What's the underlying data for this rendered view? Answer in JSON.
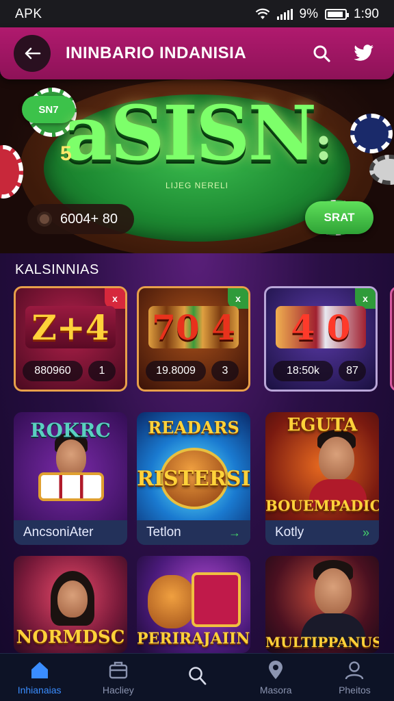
{
  "status_bar": {
    "carrier": "APK",
    "battery_text": "9%",
    "battery_level": 0.9,
    "time": "1:90"
  },
  "app_bar": {
    "back_icon": "arrow-left-icon",
    "title": "ININBARIO INDANISIA",
    "search_icon": "search-icon",
    "bird_icon": "twitter-bird-icon"
  },
  "hero": {
    "logo_text": "aSISN",
    "logo_suffix": ":",
    "subtitle": "LIJEG NERELI",
    "side_digit": "5",
    "badge": "SN7",
    "balance": "6004+ 80",
    "button_label": "SRAT",
    "colors": {
      "felt": "#1d8a32",
      "button": "#3cc24a"
    }
  },
  "section": {
    "title": "KALSINNIAS"
  },
  "slot_cards": [
    {
      "reel_text": "Z+4",
      "stat_left": "880960",
      "stat_right": "1",
      "corner": "x",
      "corner_color": "#d6283c",
      "theme": "#7a1030"
    },
    {
      "reel_text": "70 4",
      "stat_left": "19.8009",
      "stat_right": "3",
      "corner": "x",
      "corner_color": "#2f9b3a",
      "theme": "#6a2a10"
    },
    {
      "reel_text": "4 0",
      "stat_left": "18:50k",
      "stat_right": "87",
      "corner": "x",
      "corner_color": "#2f9b3a",
      "theme": "#2a1e6a"
    }
  ],
  "game_tiles_row1": [
    {
      "art_title": "ROKRC",
      "caption": "AncsoniAter",
      "has_arrow": false,
      "arrow": ""
    },
    {
      "art_title": "RISTERSI",
      "art_top": "READARS",
      "caption": "Tetlon",
      "has_arrow": true,
      "arrow": "→"
    },
    {
      "art_title": "BOUEMPADICS",
      "art_top": "EGUTA",
      "caption": "Kotly",
      "has_arrow": true,
      "arrow": "»"
    }
  ],
  "game_tiles_row2": [
    {
      "art_title": "NORMDSC"
    },
    {
      "art_title": "PERIRAJAIIND"
    },
    {
      "art_title": "MULTIPPANUS"
    }
  ],
  "bottom_nav": [
    {
      "label": "Inhianaias",
      "icon": "home-icon",
      "active": true
    },
    {
      "label": "Hacliey",
      "icon": "briefcase-icon",
      "active": false
    },
    {
      "label": "",
      "icon": "search-icon",
      "active": false
    },
    {
      "label": "Masora",
      "icon": "location-pin-icon",
      "active": false
    },
    {
      "label": "Pheitos",
      "icon": "user-icon",
      "active": false
    }
  ]
}
